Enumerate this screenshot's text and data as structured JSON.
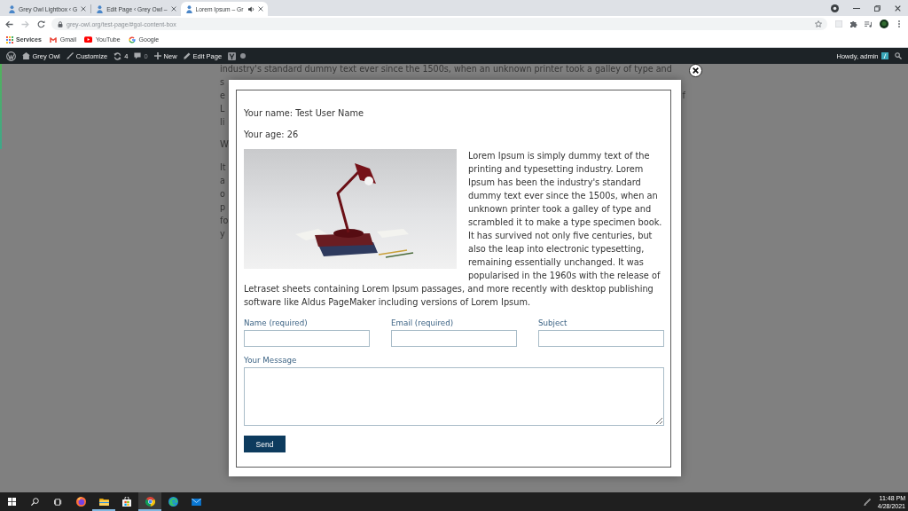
{
  "browser": {
    "tabs": [
      {
        "title": "Grey Owl Lightbox ‹ G",
        "selected": false,
        "audio": false
      },
      {
        "title": "Edit Page ‹ Grey Owl –",
        "selected": false,
        "audio": false
      },
      {
        "title": "Lorem Ipsum – Gr",
        "selected": true,
        "audio": true
      }
    ],
    "navigation": {
      "back_enabled": true,
      "forward_enabled": false
    },
    "url": "grey-owl.org/test-page/#gol-content-box",
    "bookmarks": [
      {
        "kind": "apps",
        "label": "Services"
      },
      {
        "kind": "gmail",
        "label": "Gmail"
      },
      {
        "kind": "youtube",
        "label": "YouTube"
      },
      {
        "kind": "google",
        "label": "Google"
      }
    ]
  },
  "admin_bar": {
    "items": [
      {
        "kind": "wp"
      },
      {
        "kind": "site",
        "label": "Grey Owl"
      },
      {
        "kind": "customize",
        "label": "Customize"
      },
      {
        "kind": "updates",
        "label": "4"
      },
      {
        "kind": "comments",
        "label": "0"
      },
      {
        "kind": "new",
        "label": "New"
      },
      {
        "kind": "edit",
        "label": "Edit Page"
      },
      {
        "kind": "seo"
      }
    ],
    "greeting": "Howdy, admin"
  },
  "page": {
    "lines": [
      {
        "kind": "text",
        "left": "industry's standard dummy text ever since the 1500s, when an unknown printer took a galley of type and"
      },
      {
        "kind": "text",
        "left": "s"
      },
      {
        "kind": "text",
        "left": "e",
        "right": "f"
      },
      {
        "kind": "text",
        "left": "L"
      },
      {
        "kind": "text",
        "left": "li"
      },
      {
        "kind": "heading",
        "left": "W"
      },
      {
        "kind": "text",
        "left": "It"
      },
      {
        "kind": "text",
        "left": "a"
      },
      {
        "kind": "text",
        "left": "o"
      },
      {
        "kind": "text",
        "left": "p"
      },
      {
        "kind": "text",
        "left": "fo"
      },
      {
        "kind": "text",
        "left": "y"
      }
    ]
  },
  "lightbox": {
    "details": [
      "Your name: Test User Name",
      "Your age: 26"
    ],
    "article": {
      "beside_image": "Lorem Ipsum is simply dummy text of the printing and typesetting industry. Lorem Ipsum has been the industry's standard dummy text ever since the 1500s, when an unknown printer took a galley of type and scrambled it to make a type specimen book. It has survived not only five centuries, but also the leap into electronic typesetting, remaining essentially unchanged. It was popularised in the 1960s with the release of",
      "below_image": "Letraset sheets containing Lorem Ipsum passages, and more recently with desktop publishing software like Aldus PageMaker including versions of Lorem Ipsum."
    },
    "form": {
      "fields": [
        {
          "kind": "text",
          "label": "Name (required)"
        },
        {
          "kind": "text",
          "label": "Email (required)"
        },
        {
          "kind": "text",
          "label": "Subject"
        },
        {
          "kind": "textarea",
          "label": "Your Message"
        }
      ],
      "submit": "Send"
    }
  },
  "taskbar": {
    "buttons": [
      {
        "kind": "start"
      },
      {
        "kind": "search"
      },
      {
        "kind": "task-view"
      }
    ],
    "apps": [
      {
        "kind": "firefox",
        "running": false,
        "selected": false
      },
      {
        "kind": "explorer",
        "running": true,
        "selected": false
      },
      {
        "kind": "store",
        "running": false,
        "selected": false
      },
      {
        "kind": "chrome",
        "running": true,
        "selected": true
      },
      {
        "kind": "edge",
        "running": false,
        "selected": false
      },
      {
        "kind": "mail",
        "running": false,
        "selected": false
      }
    ],
    "time": "11:48 PM",
    "date": "4/28/2021"
  }
}
